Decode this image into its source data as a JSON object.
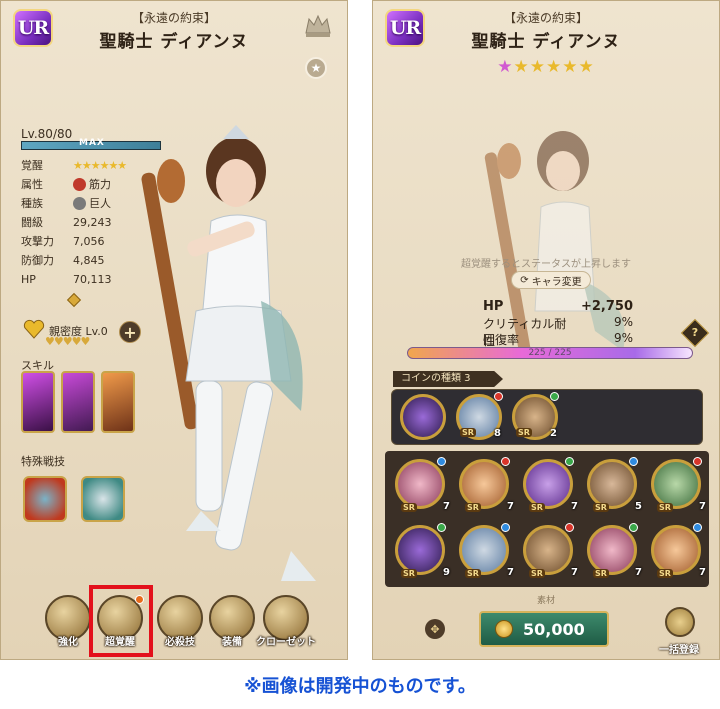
{
  "left": {
    "rarity": "UR",
    "subtitle": "【永遠の約束】",
    "name": "聖騎士 ディアンヌ",
    "level": "Lv.80/80",
    "level_state": "MAX",
    "level_progress": 1.0,
    "stats": [
      {
        "key": "覚醒",
        "value": "★★★★★★"
      },
      {
        "key": "属性",
        "value": "筋力"
      },
      {
        "key": "種族",
        "value": "巨人"
      },
      {
        "key": "闘級",
        "value": "29,243"
      },
      {
        "key": "攻撃力",
        "value": "7,056"
      },
      {
        "key": "防御力",
        "value": "4,845"
      },
      {
        "key": "HP",
        "value": "70,113"
      }
    ],
    "affinity": "親密度 Lv.0",
    "skill_section": "スキル",
    "special_section": "特殊戦技",
    "nav": [
      {
        "label": "強化"
      },
      {
        "label": "超覚醒"
      },
      {
        "label": "必殺技"
      },
      {
        "label": "装備"
      },
      {
        "label": "クローゼット"
      }
    ]
  },
  "right": {
    "rarity": "UR",
    "subtitle": "【永遠の約束】",
    "name": "聖騎士 ディアンヌ",
    "awaken_stars": {
      "first": "★",
      "rest": "★★★★★"
    },
    "faded_notice": "超覚醒するとステータスが上昇します",
    "chara_change": "キャラ変更",
    "bonuses": [
      {
        "key": "HP",
        "value": "+2,750"
      },
      {
        "key": "クリティカル耐性",
        "value": "9%"
      },
      {
        "key": "回復率",
        "value": "9%"
      }
    ],
    "progress_text": "225 / 225",
    "help": "?",
    "coin_header": "コインの種類 3",
    "coin_tray": [
      {
        "count": ""
      },
      {
        "count": "8"
      },
      {
        "count": "2"
      }
    ],
    "coin_grid": [
      {
        "count": "7"
      },
      {
        "count": "7"
      },
      {
        "count": "7"
      },
      {
        "count": "5"
      },
      {
        "count": "7"
      },
      {
        "count": "9"
      },
      {
        "count": "7"
      },
      {
        "count": "7"
      },
      {
        "count": "7"
      },
      {
        "count": "7"
      }
    ],
    "coin_tag": "SR",
    "material_label": "素材",
    "cost": "50,000",
    "bulk_label": "一括登録"
  },
  "caption": "※画像は開発中のものです。",
  "colors": {
    "panel_bg": "#ebdfc7",
    "highlight": "#e3101b",
    "caption": "#1652d4",
    "cost_bg": "#2f7458",
    "star": "#e9b92c"
  }
}
